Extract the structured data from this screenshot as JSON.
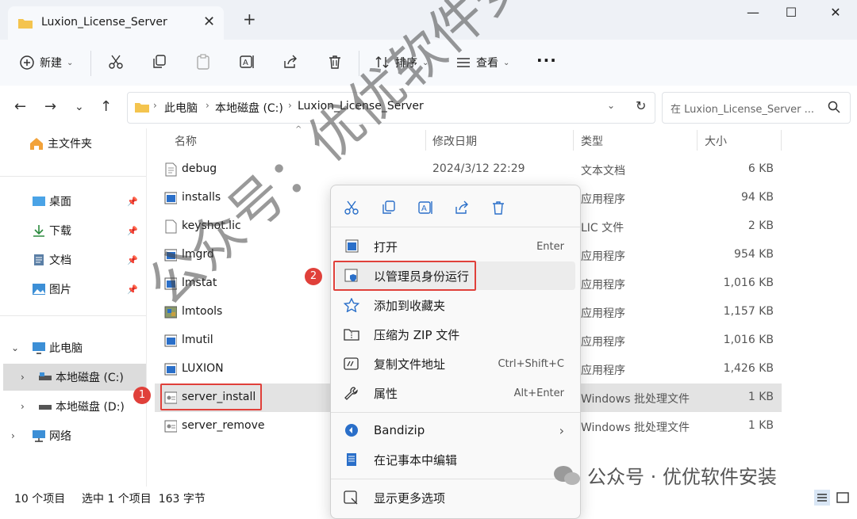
{
  "window": {
    "tab_title": "Luxion_License_Server",
    "tab_close": "✕",
    "new_tab": "+",
    "minimize": "—",
    "maximize": "☐",
    "close": "✕"
  },
  "toolbar": {
    "new_label": "新建",
    "sort_label": "排序",
    "view_label": "查看",
    "more_label": "···"
  },
  "address": {
    "crumbs": [
      "此电脑",
      "本地磁盘 (C:)",
      "Luxion_License_Server"
    ],
    "search_placeholder": "在 Luxion_License_Server ..."
  },
  "sidebar": {
    "home": "主文件夹",
    "quick": [
      {
        "label": "桌面"
      },
      {
        "label": "下载"
      },
      {
        "label": "文档"
      },
      {
        "label": "图片"
      }
    ],
    "this_pc": "此电脑",
    "drive_c": "本地磁盘 (C:)",
    "drive_d": "本地磁盘 (D:)",
    "network": "网络"
  },
  "columns": {
    "name": "名称",
    "date": "修改日期",
    "type": "类型",
    "size": "大小"
  },
  "files": [
    {
      "name": "debug",
      "date": "2024/3/12 22:29",
      "type": "文本文档",
      "size": "6 KB",
      "icon": "text-file-icon"
    },
    {
      "name": "installs",
      "date": "",
      "type": "应用程序",
      "size": "94 KB",
      "icon": "exe-icon"
    },
    {
      "name": "keyshot.lic",
      "date": "",
      "type": "LIC 文件",
      "size": "2 KB",
      "icon": "file-icon"
    },
    {
      "name": "lmgrd",
      "date": "",
      "type": "应用程序",
      "size": "954 KB",
      "icon": "exe-icon"
    },
    {
      "name": "lmstat",
      "date": "",
      "type": "应用程序",
      "size": "1,016 KB",
      "icon": "exe-icon"
    },
    {
      "name": "lmtools",
      "date": "",
      "type": "应用程序",
      "size": "1,157 KB",
      "icon": "tools-exe-icon"
    },
    {
      "name": "lmutil",
      "date": "",
      "type": "应用程序",
      "size": "1,016 KB",
      "icon": "exe-icon"
    },
    {
      "name": "LUXION",
      "date": "",
      "type": "应用程序",
      "size": "1,426 KB",
      "icon": "exe-icon"
    },
    {
      "name": "server_install",
      "date": "",
      "type": "Windows 批处理文件",
      "size": "1 KB",
      "icon": "batch-file-icon"
    },
    {
      "name": "server_remove",
      "date": "",
      "type": "Windows 批处理文件",
      "size": "1 KB",
      "icon": "batch-file-icon"
    }
  ],
  "context_menu": {
    "open": "打开",
    "open_key": "Enter",
    "run_admin": "以管理员身份运行",
    "add_fav": "添加到收藏夹",
    "zip": "压缩为 ZIP 文件",
    "copy_path": "复制文件地址",
    "copy_path_key": "Ctrl+Shift+C",
    "properties": "属性",
    "properties_key": "Alt+Enter",
    "bandizip": "Bandizip",
    "notepad": "在记事本中编辑",
    "more": "显示更多选项"
  },
  "annotations": {
    "step1": "1",
    "step2": "2"
  },
  "status": {
    "count": "10 个项目",
    "selected": "选中 1 个项目  163 字节"
  },
  "watermark": {
    "diagonal": "公众号：优优软件安装",
    "footer": "公众号 · 优优软件安装"
  },
  "colors": {
    "accent": "#0067c0",
    "annotation_red": "#e0403a",
    "folder": "#f4c44e"
  }
}
